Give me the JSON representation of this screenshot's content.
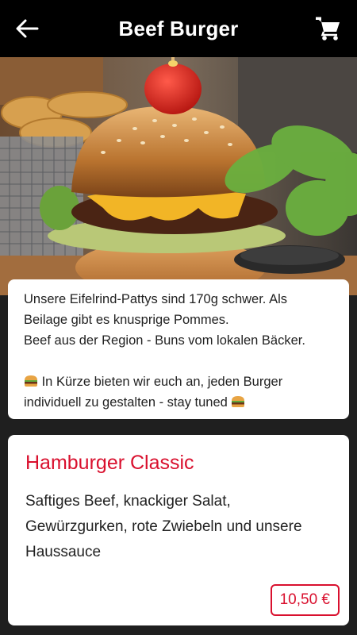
{
  "header": {
    "title": "Beef Burger",
    "back_icon": "arrow-left-icon",
    "cart_icon": "shopping-cart-icon"
  },
  "hero": {
    "image": "burger-photo"
  },
  "description": {
    "line1": "Unsere Eifelrind-Pattys sind 170g schwer. Als",
    "line2": "Beilage gibt es knusprige Pommes.",
    "line3": "Beef aus der Region - Buns vom lokalen Bäcker.",
    "line4_part1": "In Kürze bieten wir euch an, jeden Burger",
    "line5_part1": "individuell zu gestalten - stay tuned",
    "emoji_icon": "burger-emoji-icon"
  },
  "menu_item": {
    "name": "Hamburger Classic",
    "description_line1": "Saftiges Beef, knackiger Salat,",
    "description_line2": "Gewürzgurken, rote Zwiebeln und unsere",
    "description_line3": "Haussauce",
    "price": "10,50 €"
  },
  "colors": {
    "accent": "#d9102e",
    "header_bg": "#000000",
    "page_bg": "#1f1f1f"
  }
}
